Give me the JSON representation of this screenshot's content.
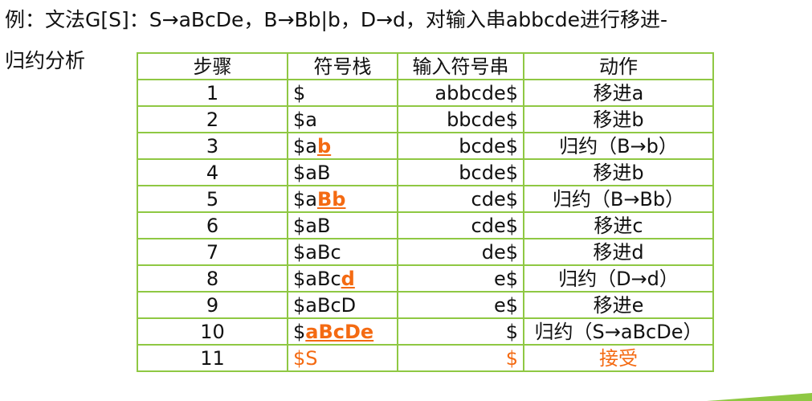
{
  "heading": {
    "line1": "例：文法G[S]：S→aBcDe，B→Bb|b，D→d，对输入串abbcde进行移进-",
    "line2": "归约分析"
  },
  "table": {
    "headers": [
      "步骤",
      "符号栈",
      "输入符号串",
      "动作"
    ],
    "rows": [
      {
        "step": "1",
        "stack_plain": "$",
        "stack_hl": "",
        "input": "abbcde$",
        "action": "移进a"
      },
      {
        "step": "2",
        "stack_plain": "$a",
        "stack_hl": "",
        "input": "bbcde$",
        "action": "移进b"
      },
      {
        "step": "3",
        "stack_plain": "$a",
        "stack_hl": "b",
        "input": "bcde$",
        "action": "归约（B→b）"
      },
      {
        "step": "4",
        "stack_plain": "$aB",
        "stack_hl": "",
        "input": "bcde$",
        "action": "移进b"
      },
      {
        "step": "5",
        "stack_plain": "$a",
        "stack_hl": "Bb",
        "input": "cde$",
        "action": "归约（B→Bb）"
      },
      {
        "step": "6",
        "stack_plain": "$aB",
        "stack_hl": "",
        "input": "cde$",
        "action": "移进c"
      },
      {
        "step": "7",
        "stack_plain": "$aBc",
        "stack_hl": "",
        "input": "de$",
        "action": "移进d"
      },
      {
        "step": "8",
        "stack_plain": "$aBc",
        "stack_hl": "d",
        "input": "e$",
        "action": "归约（D→d）"
      },
      {
        "step": "9",
        "stack_plain": "$aBcD",
        "stack_hl": "",
        "input": "e$",
        "action": "移进e"
      },
      {
        "step": "10",
        "stack_plain": "$",
        "stack_hl": "aBcDe",
        "input": "$",
        "action": "归约（S→aBcDe）"
      },
      {
        "step": "11",
        "stack_final": "$S",
        "input_final": "$",
        "action_final": "接受"
      }
    ]
  },
  "colors": {
    "border": "#8fc843",
    "highlight": "#f46a12",
    "accent_bar": "#8fc843"
  }
}
